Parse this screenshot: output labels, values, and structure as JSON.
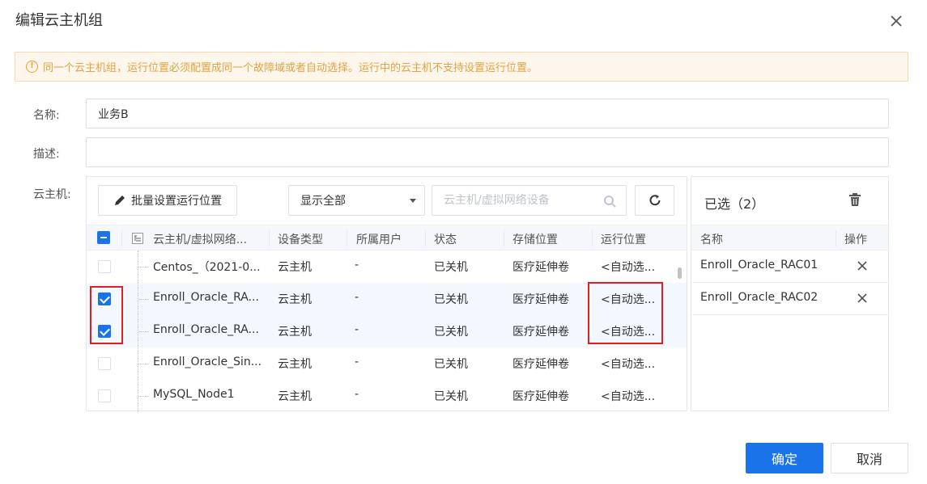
{
  "dialog": {
    "title": "编辑云主机组",
    "warning": "同一个云主机组，运行位置必须配置成同一个故障域或者自动选择。运行中的云主机不支持设置运行位置。"
  },
  "form": {
    "name_label": "名称:",
    "name_value": "业务B",
    "desc_label": "描述:",
    "desc_value": "",
    "vm_label": "云主机:"
  },
  "toolbar": {
    "batch_label": "批量设置运行位置",
    "filter_value": "显示全部",
    "search_placeholder": "云主机/虚拟网络设备"
  },
  "table": {
    "headers": [
      "云主机/虚拟网络...",
      "设备类型",
      "所属用户",
      "状态",
      "存储位置",
      "运行位置"
    ],
    "rows": [
      {
        "name": "Centos_（2021-0...",
        "type": "云主机",
        "owner": "-",
        "status": "已关机",
        "storage": "医疗延伸卷",
        "location": "<自动选...",
        "checked": false
      },
      {
        "name": "Enroll_Oracle_RA...",
        "type": "云主机",
        "owner": "-",
        "status": "已关机",
        "storage": "医疗延伸卷",
        "location": "<自动选...",
        "checked": true
      },
      {
        "name": "Enroll_Oracle_RA...",
        "type": "云主机",
        "owner": "-",
        "status": "已关机",
        "storage": "医疗延伸卷",
        "location": "<自动选...",
        "checked": true
      },
      {
        "name": "Enroll_Oracle_Sin...",
        "type": "云主机",
        "owner": "-",
        "status": "已关机",
        "storage": "医疗延伸卷",
        "location": "<自动选...",
        "checked": false
      },
      {
        "name": "MySQL_Node1",
        "type": "云主机",
        "owner": "-",
        "status": "已关机",
        "storage": "医疗延伸卷",
        "location": "<自动选...",
        "checked": false
      }
    ]
  },
  "selected": {
    "title": "已选（2）",
    "headers": [
      "名称",
      "操作"
    ],
    "items": [
      "Enroll_Oracle_RAC01",
      "Enroll_Oracle_RAC02"
    ]
  },
  "footer": {
    "ok_label": "确定",
    "cancel_label": "取消"
  },
  "colors": {
    "primary": "#1a73e8",
    "warning": "#e6a23c",
    "highlight": "#e02020"
  }
}
